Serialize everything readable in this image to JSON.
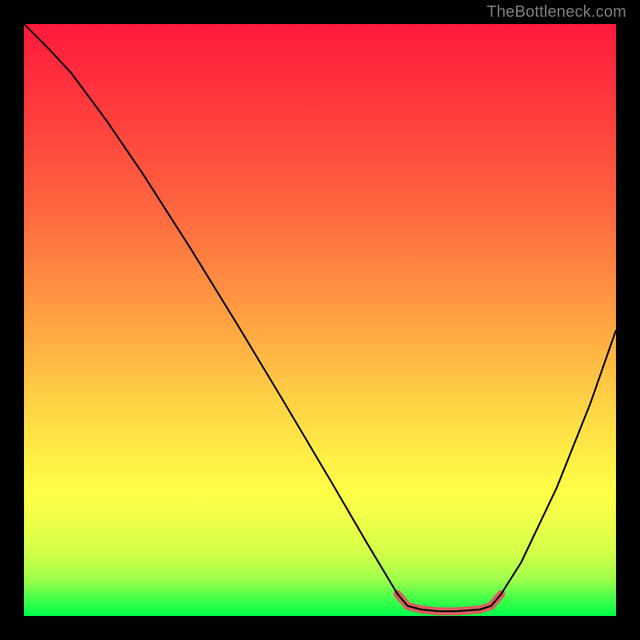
{
  "watermark": "TheBottleneck.com",
  "chart_data": {
    "type": "line",
    "title": "",
    "xlabel": "",
    "ylabel": "",
    "xlim": [
      0,
      1
    ],
    "ylim": [
      0,
      1
    ],
    "gradient_colors": {
      "top": "#ff1a3c",
      "mid_upper": "#ff8641",
      "mid": "#ffff47",
      "bottom": "#00ff4b"
    },
    "series": [
      {
        "name": "bottleneck-curve",
        "x": [
          0.0,
          0.04,
          0.08,
          0.14,
          0.2,
          0.28,
          0.36,
          0.44,
          0.52,
          0.58,
          0.631,
          0.648,
          0.671,
          0.7,
          0.73,
          0.77,
          0.789,
          0.806,
          0.84,
          0.9,
          0.957,
          1.0
        ],
        "y": [
          1.0,
          0.96,
          0.917,
          0.836,
          0.748,
          0.623,
          0.493,
          0.36,
          0.225,
          0.122,
          0.037,
          0.017,
          0.011,
          0.008,
          0.008,
          0.011,
          0.017,
          0.037,
          0.091,
          0.217,
          0.36,
          0.483
        ]
      }
    ],
    "highlight_segment": {
      "name": "optimal-range",
      "color": "#da5e5e",
      "x": [
        0.631,
        0.648,
        0.671,
        0.7,
        0.73,
        0.77,
        0.789,
        0.806
      ],
      "y": [
        0.037,
        0.017,
        0.011,
        0.008,
        0.008,
        0.011,
        0.017,
        0.037
      ]
    }
  }
}
